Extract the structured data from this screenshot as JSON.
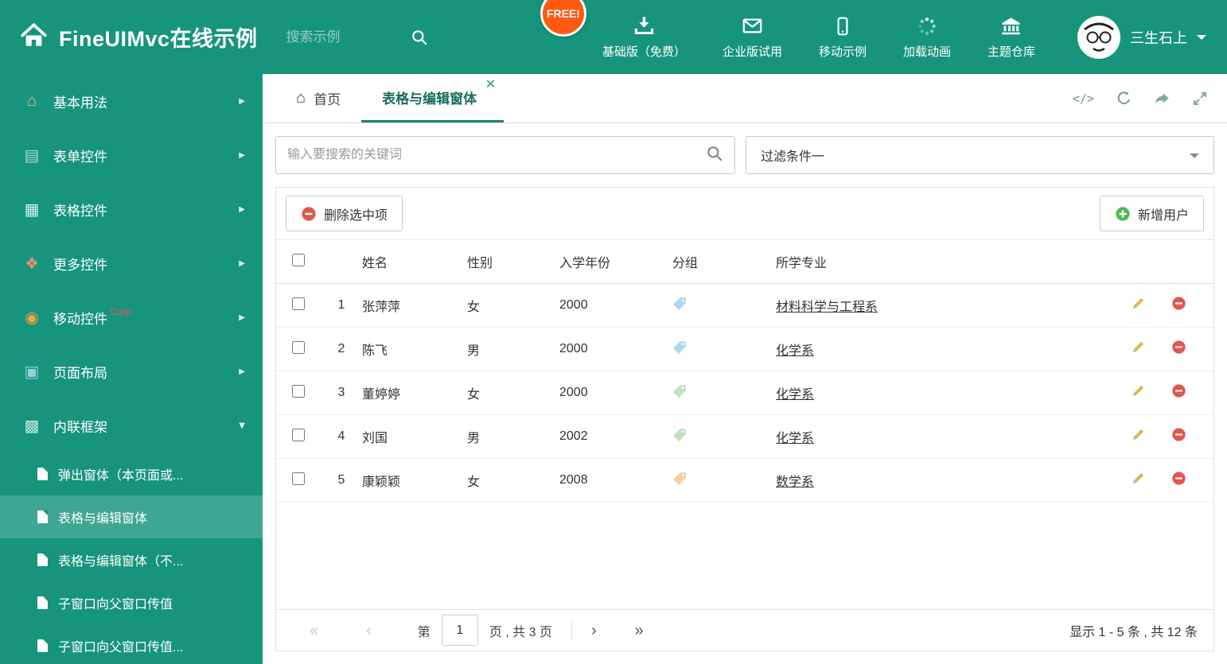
{
  "colors": {
    "theme_green": "#17947c",
    "active_tab_underline": "#1b8573",
    "free_badge_bg": "#ff5a12",
    "delete_red": "#e2574c",
    "add_green": "#53b556",
    "corp_badge_red": "#ff4a4a"
  },
  "header": {
    "title": "FineUIMvc在线示例",
    "search_placeholder": "搜索示例",
    "free_badge": "FREE!",
    "nav": [
      {
        "label": "基础版（免费）",
        "icon": "download-icon"
      },
      {
        "label": "企业版试用",
        "icon": "envelope-icon"
      },
      {
        "label": "移动示例",
        "icon": "mobile-icon"
      },
      {
        "label": "加载动画",
        "icon": "spinner-icon"
      },
      {
        "label": "主题仓库",
        "icon": "bank-icon"
      }
    ],
    "user": {
      "name": "三生石上"
    }
  },
  "sidebar": {
    "items": [
      {
        "label": "基本用法",
        "icon": "home-icon",
        "icon_color": "#eec06a"
      },
      {
        "label": "表单控件",
        "icon": "form-icon",
        "icon_color": "#a8dcd0"
      },
      {
        "label": "表格控件",
        "icon": "table-icon",
        "icon_color": "#d6efe9"
      },
      {
        "label": "更多控件",
        "icon": "widgets-icon",
        "icon_color": "#e98f7f"
      },
      {
        "label": "移动控件",
        "badge": "Corp.",
        "icon": "signal-icon",
        "icon_color": "#f0a24a"
      },
      {
        "label": "页面布局",
        "icon": "layout-icon",
        "icon_color": "#93cfdd"
      },
      {
        "label": "内联框架",
        "icon": "iframe-icon",
        "icon_color": "#c5e8df",
        "expanded": true
      }
    ],
    "subitems": [
      {
        "label": "弹出窗体（本页面或..."
      },
      {
        "label": "表格与编辑窗体",
        "active": true
      },
      {
        "label": "表格与编辑窗体（不..."
      },
      {
        "label": "子窗口向父窗口传值"
      },
      {
        "label": "子窗口向父窗口传值..."
      }
    ]
  },
  "tabs": {
    "home": "首页",
    "active": "表格与编辑窗体"
  },
  "filters": {
    "search_placeholder": "输入要搜索的关键词",
    "filter_value": "过滤条件一"
  },
  "toolbar": {
    "delete": "删除选中项",
    "add": "新增用户"
  },
  "grid": {
    "headers": {
      "name": "姓名",
      "gender": "性别",
      "year": "入学年份",
      "group": "分组",
      "major": "所学专业"
    },
    "rows": [
      {
        "num": "1",
        "name": "张萍萍",
        "gender": "女",
        "year": "2000",
        "tag_color": "#6fb9e3",
        "major": "材料科学与工程系"
      },
      {
        "num": "2",
        "name": "陈飞",
        "gender": "男",
        "year": "2000",
        "tag_color": "#6fb9e3",
        "major": "化学系"
      },
      {
        "num": "3",
        "name": "董婷婷",
        "gender": "女",
        "year": "2000",
        "tag_color": "#8fca8f",
        "major": "化学系"
      },
      {
        "num": "4",
        "name": "刘国",
        "gender": "男",
        "year": "2002",
        "tag_color": "#8fca8f",
        "major": "化学系"
      },
      {
        "num": "5",
        "name": "康颖颖",
        "gender": "女",
        "year": "2008",
        "tag_color": "#f2a75c",
        "major": "数学系"
      }
    ]
  },
  "pagination": {
    "prefix": "第",
    "page": "1",
    "suffix": "页 , 共 3 页",
    "summary": "显示 1 - 5 条 , 共 12 条"
  }
}
